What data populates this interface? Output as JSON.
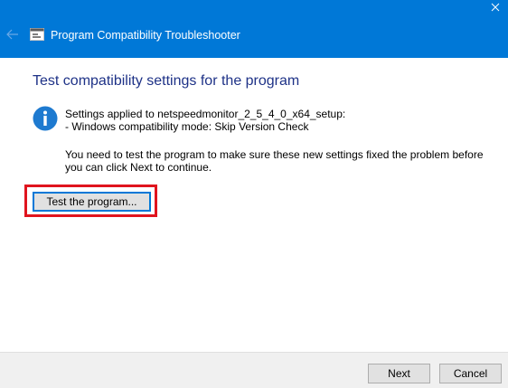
{
  "window": {
    "title": "Program Compatibility Troubleshooter",
    "titlebar_color": "#0078d7"
  },
  "icons": {
    "back": "back-arrow-icon",
    "app": "troubleshooter-app-icon",
    "info": "info-icon",
    "close": "close-icon"
  },
  "main": {
    "heading": "Test compatibility settings for the program",
    "settings_line1": "Settings applied to netspeedmonitor_2_5_4_0_x64_setup:",
    "settings_line2": "- Windows compatibility mode: Skip Version Check",
    "instruction_line1": "You need to test the program to make sure these new settings fixed the problem before",
    "instruction_line2": "you can click Next to continue.",
    "test_button_label": "Test the program...",
    "highlight_color": "#e0141e"
  },
  "footer": {
    "next_label": "Next",
    "cancel_label": "Cancel"
  }
}
